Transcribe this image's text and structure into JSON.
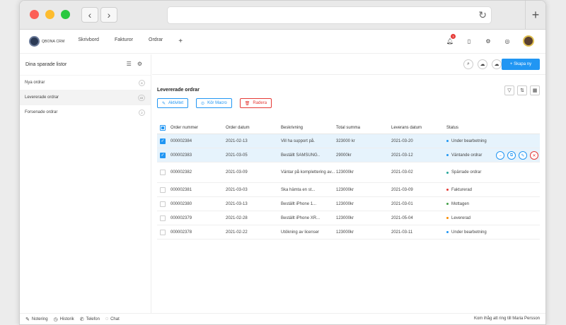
{
  "app": {
    "logo_text": "QBONA CRM"
  },
  "topnav": [
    "Skrivbord",
    "Fakturor",
    "Ordrar",
    "+"
  ],
  "notifications": {
    "count": "3"
  },
  "sidebar": {
    "title": "Dina sparade listor",
    "items": [
      {
        "label": "Nya ordrar",
        "count": "6"
      },
      {
        "label": "Levererade ordrar",
        "count": "43"
      },
      {
        "label": "Forsenade ordrar",
        "count": "2"
      }
    ]
  },
  "main": {
    "create_button": "+ Skapa ny",
    "list_title": "Levererade ordrar",
    "actions": {
      "activate": "Aktivitet",
      "macro": "Kör Macro",
      "delete": "Radera"
    }
  },
  "table": {
    "headers": [
      "Order nummer",
      "Order datum",
      "Beskrivning",
      "Total summa",
      "Leverans datum",
      "Status"
    ],
    "rows": [
      {
        "nr": "000002384",
        "date": "2021-02-13",
        "desc": "Vill ha support på.",
        "sum": "323000 kr",
        "delivery": "2021-03-20",
        "status": "Under bearbetning",
        "status_color": "#2196f3",
        "checked": true
      },
      {
        "nr": "000002383",
        "date": "2021-03-05",
        "desc": "Beställt SAMSUNG..",
        "sum": "29000kr",
        "delivery": "2021-03-12",
        "status": "Väntande ordrar",
        "status_color": "#2196f3",
        "checked": true
      },
      {
        "nr": "000002382",
        "date": "2021-03-09",
        "desc": "Väntar på komplettering av...",
        "sum": "123000kr",
        "delivery": "2021-03-02",
        "status": "Spärrade ordrar",
        "status_color": "#26a69a",
        "checked": false
      },
      {
        "nr": "000002381",
        "date": "2021-03-03",
        "desc": "Ska hämta en st...",
        "sum": "123000kr",
        "delivery": "2021-03-09",
        "status": "Fakturerad",
        "status_color": "#e53935",
        "checked": false
      },
      {
        "nr": "000002380",
        "date": "2021-03-13",
        "desc": "Beställt iPhone 1...",
        "sum": "123000kr",
        "delivery": "2021-03-01",
        "status": "Mottagen",
        "status_color": "#43a047",
        "checked": false
      },
      {
        "nr": "000002379",
        "date": "2021-02-28",
        "desc": "Beställt iPhone XR...",
        "sum": "123000kr",
        "delivery": "2021-05-04",
        "status": "Levererad",
        "status_color": "#fb8c00",
        "checked": false
      },
      {
        "nr": "000002378",
        "date": "2021-02-22",
        "desc": "Utökning av licenser",
        "sum": "123000kr",
        "delivery": "2021-03-11",
        "status": "Under bearbetning",
        "status_color": "#2196f3",
        "checked": false
      }
    ]
  },
  "footer": {
    "items": [
      "Notering",
      "Historik",
      "Telefon",
      "Chat"
    ],
    "reminder": "Kom ihåg att ring till Maria Persson"
  },
  "colors": {
    "accent": "#2196f3",
    "danger": "#e53935"
  }
}
